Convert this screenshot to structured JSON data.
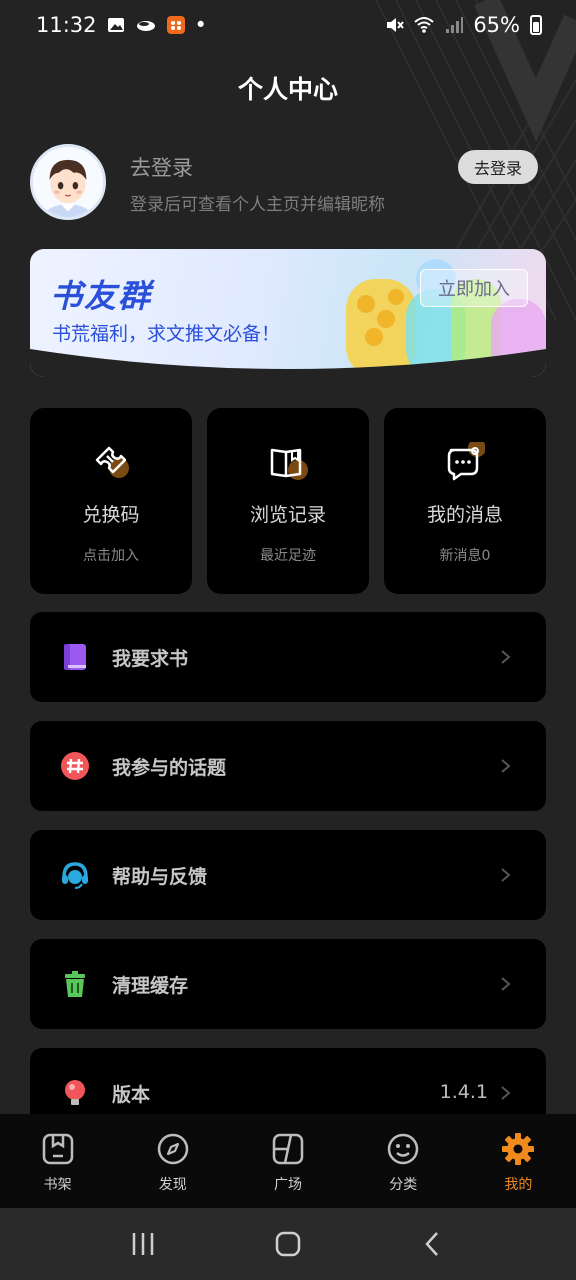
{
  "status_bar": {
    "time": "11:32",
    "battery": "65%",
    "notification_dot": "•"
  },
  "page_title": "个人中心",
  "profile": {
    "title": "去登录",
    "subtitle": "登录后可查看个人主页并编辑昵称",
    "login_button": "去登录"
  },
  "banner": {
    "title": "书友群",
    "subtitle": "书荒福利，求文推文必备！",
    "join_button": "立即加入"
  },
  "quick_cards": [
    {
      "label": "兑换码",
      "sub": "点击加入",
      "icon": "ticket-icon"
    },
    {
      "label": "浏览记录",
      "sub": "最近足迹",
      "icon": "book-history-icon"
    },
    {
      "label": "我的消息",
      "sub": "新消息0",
      "icon": "message-icon"
    }
  ],
  "menu": [
    {
      "label": "我要求书",
      "icon": "book-request-icon",
      "color": "#9b59f0"
    },
    {
      "label": "我参与的话题",
      "icon": "hashtag-icon",
      "color": "#f0555a"
    },
    {
      "label": "帮助与反馈",
      "icon": "headset-icon",
      "color": "#2aa8e0"
    },
    {
      "label": "清理缓存",
      "icon": "trash-icon",
      "color": "#58c65a"
    },
    {
      "label": "版本",
      "icon": "bulb-icon",
      "color": "#f0555a",
      "value": "1.4.1"
    }
  ],
  "bottom_nav": [
    {
      "label": "书架",
      "icon": "bookshelf-icon"
    },
    {
      "label": "发现",
      "icon": "compass-icon"
    },
    {
      "label": "广场",
      "icon": "square-icon"
    },
    {
      "label": "分类",
      "icon": "smile-icon"
    },
    {
      "label": "我的",
      "icon": "settings-gear-icon",
      "active": true
    }
  ],
  "colors": {
    "accent": "#f08a1d",
    "background": "#232323",
    "card": "#000000"
  }
}
